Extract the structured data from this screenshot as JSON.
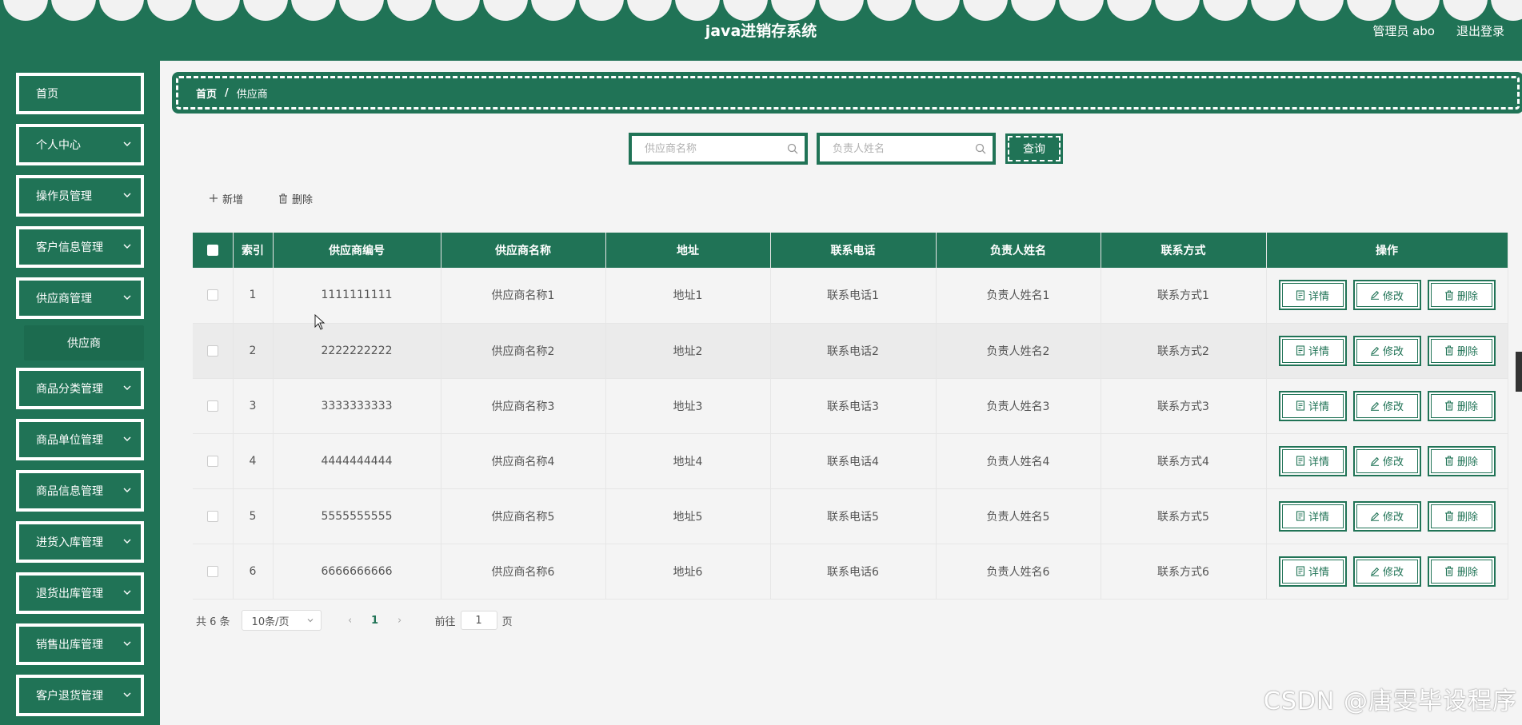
{
  "header": {
    "title": "java进销存系统",
    "admin_label": "管理员 abo",
    "logout_label": "退出登录",
    "color": "#207356"
  },
  "sidebar": {
    "items": [
      {
        "label": "首页",
        "has_chevron": false
      },
      {
        "label": "个人中心",
        "has_chevron": true
      },
      {
        "label": "操作员管理",
        "has_chevron": true
      },
      {
        "label": "客户信息管理",
        "has_chevron": true
      },
      {
        "label": "供应商管理",
        "has_chevron": true,
        "expanded": true
      },
      {
        "label": "商品分类管理",
        "has_chevron": true
      },
      {
        "label": "商品单位管理",
        "has_chevron": true
      },
      {
        "label": "商品信息管理",
        "has_chevron": true
      },
      {
        "label": "进货入库管理",
        "has_chevron": true
      },
      {
        "label": "退货出库管理",
        "has_chevron": true
      },
      {
        "label": "销售出库管理",
        "has_chevron": true
      },
      {
        "label": "客户退货管理",
        "has_chevron": true
      }
    ],
    "submenu": {
      "label": "供应商"
    }
  },
  "breadcrumb": {
    "home": "首页",
    "separator": "/",
    "current": "供应商"
  },
  "search": {
    "supplier_name_placeholder": "供应商名称",
    "manager_name_placeholder": "负责人姓名",
    "query_label": "查询"
  },
  "toolbar": {
    "add_label": "新增",
    "delete_label": "删除"
  },
  "table": {
    "columns": [
      "索引",
      "供应商编号",
      "供应商名称",
      "地址",
      "联系电话",
      "负责人姓名",
      "联系方式",
      "操作"
    ],
    "rows": [
      {
        "index": "1",
        "code": "1111111111",
        "name": "供应商名称1",
        "address": "地址1",
        "phone": "联系电话1",
        "manager": "负责人姓名1",
        "contact": "联系方式1"
      },
      {
        "index": "2",
        "code": "2222222222",
        "name": "供应商名称2",
        "address": "地址2",
        "phone": "联系电话2",
        "manager": "负责人姓名2",
        "contact": "联系方式2"
      },
      {
        "index": "3",
        "code": "3333333333",
        "name": "供应商名称3",
        "address": "地址3",
        "phone": "联系电话3",
        "manager": "负责人姓名3",
        "contact": "联系方式3"
      },
      {
        "index": "4",
        "code": "4444444444",
        "name": "供应商名称4",
        "address": "地址4",
        "phone": "联系电话4",
        "manager": "负责人姓名4",
        "contact": "联系方式4"
      },
      {
        "index": "5",
        "code": "5555555555",
        "name": "供应商名称5",
        "address": "地址5",
        "phone": "联系电话5",
        "manager": "负责人姓名5",
        "contact": "联系方式5"
      },
      {
        "index": "6",
        "code": "6666666666",
        "name": "供应商名称6",
        "address": "地址6",
        "phone": "联系电话6",
        "manager": "负责人姓名6",
        "contact": "联系方式6"
      }
    ],
    "actions": {
      "detail": "详情",
      "edit": "修改",
      "delete": "删除"
    }
  },
  "pagination": {
    "total": "共 6 条",
    "page_size": "10条/页",
    "current_page": "1",
    "goto_prefix": "前往",
    "goto_value": "1",
    "goto_suffix": "页"
  },
  "watermark": "CSDN @唐雯毕设程序"
}
